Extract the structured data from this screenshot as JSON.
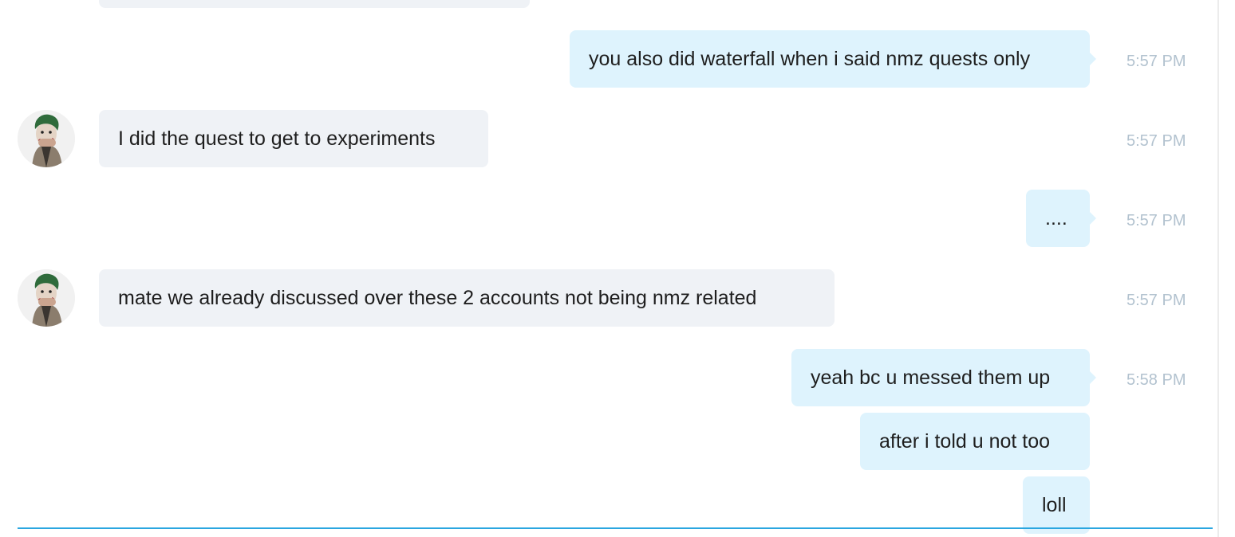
{
  "conversation": {
    "messages": [
      {
        "id": "m1",
        "direction": "out",
        "text": "you also did waterfall when i said nmz quests only",
        "time": "5:57 PM"
      },
      {
        "id": "m2",
        "direction": "in",
        "text": "I did the quest to get to experiments",
        "time": "5:57 PM",
        "avatar": "contact-avatar"
      },
      {
        "id": "m3",
        "direction": "out",
        "text": "....",
        "time": "5:57 PM"
      },
      {
        "id": "m4",
        "direction": "in",
        "text": "mate we already discussed over these 2 accounts not being nmz related",
        "time": "5:57 PM",
        "avatar": "contact-avatar"
      },
      {
        "id": "m5",
        "direction": "out",
        "text": "yeah bc u messed them up",
        "time": "5:58 PM"
      },
      {
        "id": "m6",
        "direction": "out",
        "text": "after i told u not too"
      },
      {
        "id": "m7",
        "direction": "out",
        "text": "loll"
      }
    ]
  },
  "colors": {
    "incoming_bubble": "#eff2f6",
    "outgoing_bubble": "#def3fd",
    "timestamp": "#b2c2cf",
    "composer_border": "#2aa6e0"
  }
}
